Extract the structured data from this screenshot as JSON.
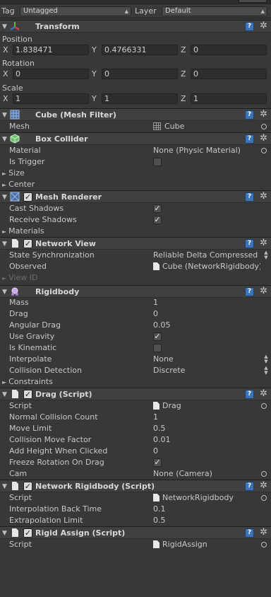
{
  "tag_bar": {
    "tag_label": "Tag",
    "tag_value": "Untagged",
    "layer_label": "Layer",
    "layer_value": "Default"
  },
  "transform": {
    "title": "Transform",
    "position_label": "Position",
    "position": {
      "x": "1.838471",
      "y": "0.4766331",
      "z": "0"
    },
    "rotation_label": "Rotation",
    "rotation": {
      "x": "0",
      "y": "0",
      "z": "0"
    },
    "scale_label": "Scale",
    "scale": {
      "x": "1",
      "y": "1",
      "z": "1"
    },
    "axis": {
      "x": "X",
      "y": "Y",
      "z": "Z"
    }
  },
  "mesh_filter": {
    "title": "Cube (Mesh Filter)",
    "mesh_label": "Mesh",
    "mesh_value": "Cube"
  },
  "box_collider": {
    "title": "Box Collider",
    "material_label": "Material",
    "material_value": "None (Physic Material)",
    "is_trigger_label": "Is Trigger",
    "is_trigger": false,
    "size_label": "Size",
    "center_label": "Center"
  },
  "mesh_renderer": {
    "title": "Mesh Renderer",
    "enabled": true,
    "cast_shadows_label": "Cast Shadows",
    "cast_shadows": true,
    "receive_shadows_label": "Receive Shadows",
    "receive_shadows": true,
    "materials_label": "Materials"
  },
  "network_view": {
    "title": "Network View",
    "enabled": true,
    "state_sync_label": "State Synchronization",
    "state_sync_value": "Reliable Delta Compressed",
    "observed_label": "Observed",
    "observed_value": "Cube (NetworkRigidbody)",
    "view_id_label": "View ID"
  },
  "rigidbody": {
    "title": "Rigidbody",
    "mass_label": "Mass",
    "mass": "1",
    "drag_label": "Drag",
    "drag": "0",
    "angular_drag_label": "Angular Drag",
    "angular_drag": "0.05",
    "use_gravity_label": "Use Gravity",
    "use_gravity": true,
    "is_kinematic_label": "Is Kinematic",
    "is_kinematic": false,
    "interpolate_label": "Interpolate",
    "interpolate": "None",
    "collision_detection_label": "Collision Detection",
    "collision_detection": "Discrete",
    "constraints_label": "Constraints"
  },
  "drag_script": {
    "title": "Drag (Script)",
    "enabled": true,
    "script_label": "Script",
    "script_value": "Drag",
    "normal_collision_count_label": "Normal Collision Count",
    "normal_collision_count": "1",
    "move_limit_label": "Move Limit",
    "move_limit": "0.5",
    "collision_move_factor_label": "Collision Move Factor",
    "collision_move_factor": "0.01",
    "add_height_label": "Add Height When Clicked",
    "add_height": "0",
    "freeze_rotation_label": "Freeze Rotation On Drag",
    "freeze_rotation": true,
    "cam_label": "Cam",
    "cam_value": "None (Camera)"
  },
  "network_rigidbody": {
    "title": "Network Rigidbody (Script)",
    "enabled": true,
    "script_label": "Script",
    "script_value": "NetworkRigidbody",
    "interp_back_time_label": "Interpolation Back Time",
    "interp_back_time": "0.1",
    "extrapolation_limit_label": "Extrapolation Limit",
    "extrapolation_limit": "0.5"
  },
  "rigid_assign": {
    "title": "Rigid Assign (Script)",
    "enabled": true,
    "script_label": "Script",
    "script_value": "RigidAssign"
  },
  "icons": {
    "help": "?",
    "gear": "✲",
    "fold_open": "▼",
    "fold_closed": "►",
    "check": "✓"
  }
}
